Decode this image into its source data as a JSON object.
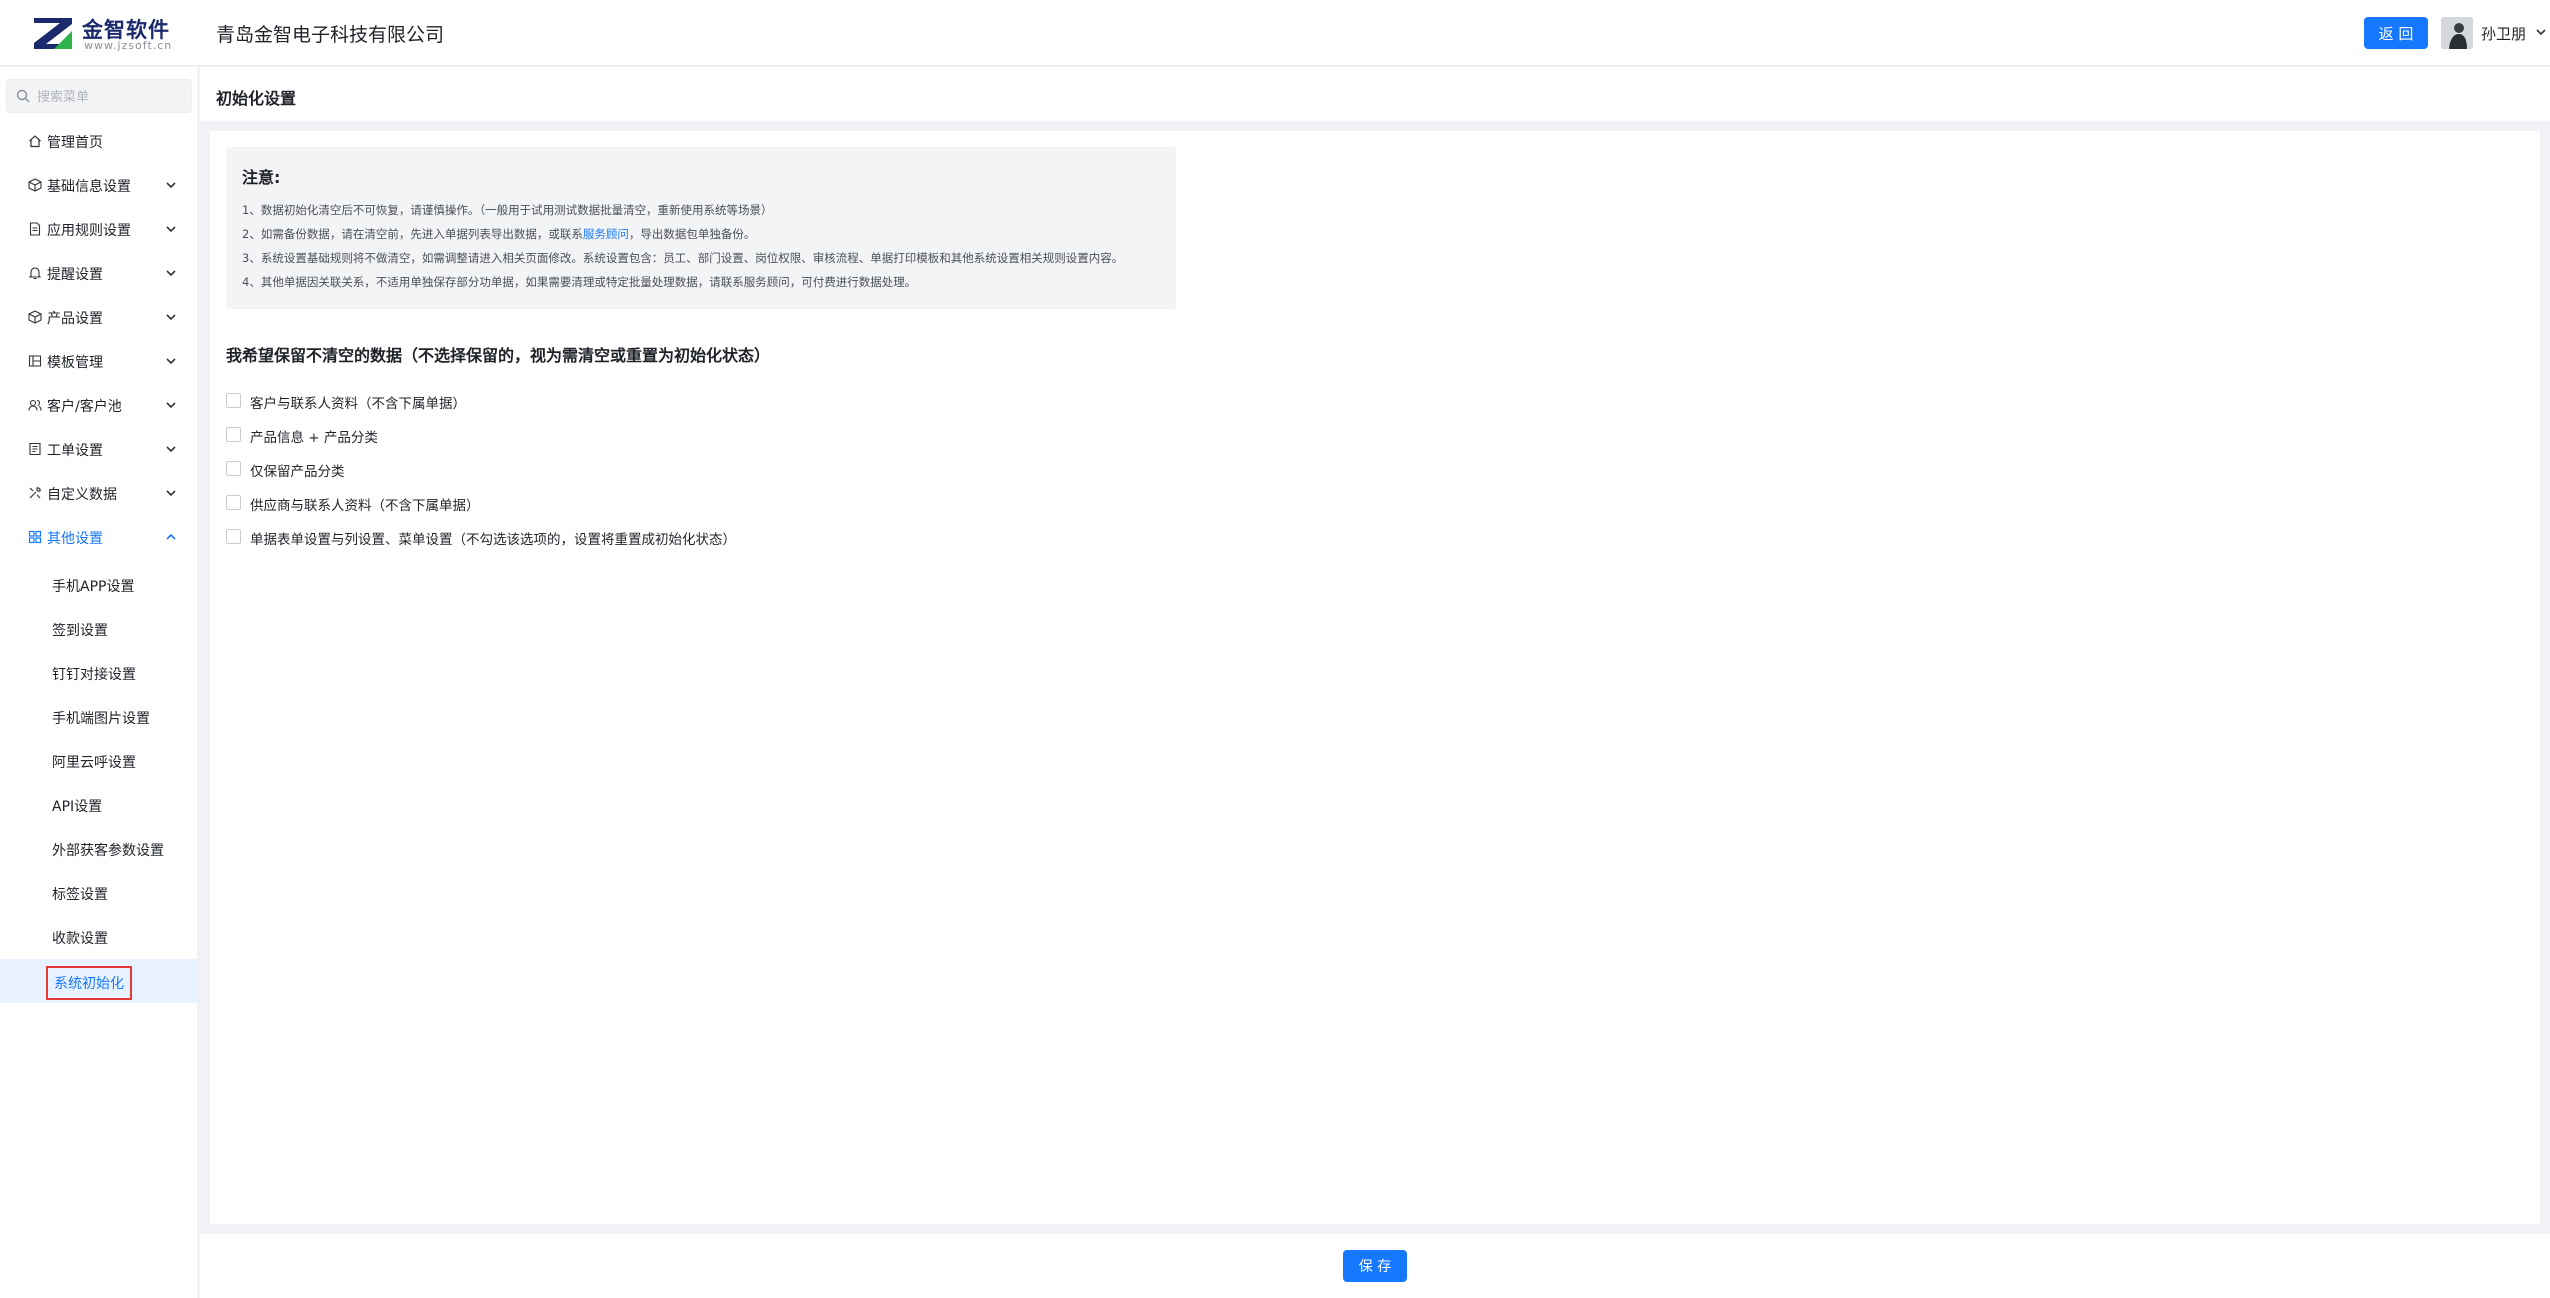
{
  "header": {
    "logo_title": "金智软件",
    "logo_url": "www.jzsoft.cn",
    "company_name": "青岛金智电子科技有限公司",
    "back_label": "返 回",
    "user_name": "孙卫朋",
    "brand_color": "#1677ff"
  },
  "sidebar": {
    "search_placeholder": "搜索菜单",
    "items": [
      {
        "label": "管理首页",
        "icon": "home-icon"
      },
      {
        "label": "基础信息设置",
        "icon": "cube-icon"
      },
      {
        "label": "应用规则设置",
        "icon": "document-icon"
      },
      {
        "label": "提醒设置",
        "icon": "bell-icon"
      },
      {
        "label": "产品设置",
        "icon": "box-icon"
      },
      {
        "label": "模板管理",
        "icon": "template-icon"
      },
      {
        "label": "客户/客户池",
        "icon": "users-icon"
      },
      {
        "label": "工单设置",
        "icon": "ticket-icon"
      },
      {
        "label": "自定义数据",
        "icon": "tools-icon"
      },
      {
        "label": "其他设置",
        "icon": "grid-icon"
      }
    ],
    "subitems": [
      {
        "label": "手机APP设置"
      },
      {
        "label": "签到设置"
      },
      {
        "label": "钉钉对接设置"
      },
      {
        "label": "手机端图片设置"
      },
      {
        "label": "阿里云呼设置"
      },
      {
        "label": "API设置"
      },
      {
        "label": "外部获客参数设置"
      },
      {
        "label": "标签设置"
      },
      {
        "label": "收款设置"
      },
      {
        "label": "系统初始化"
      }
    ]
  },
  "page": {
    "title": "初始化设置",
    "notice_title": "注意:",
    "notice_lines": [
      "1、数据初始化清空后不可恢复，请谨慎操作。（一般用于试用测试数据批量清空，重新使用系统等场景）",
      "3、系统设置基础规则将不做清空，如需调整请进入相关页面修改。系统设置包含：员工、部门设置、岗位权限、审核流程、单据打印模板和其他系统设置相关规则设置内容。",
      "4、其他单据因关联关系，不适用单独保存部分功单据，如果需要清理或特定批量处理数据，请联系服务顾问，可付费进行数据处理。"
    ],
    "notice_line2_before": "2、如需备份数据，请在清空前，先进入单据列表导出数据，或联系",
    "notice_line2_link": "服务顾问",
    "notice_line2_after": "，导出数据包单独备份。",
    "section_heading": "我希望保留不清空的数据（不选择保留的，视为需清空或重置为初始化状态）",
    "options": [
      {
        "label": "客户与联系人资料（不含下属单据）",
        "checked": false
      },
      {
        "label": "产品信息 + 产品分类",
        "checked": false
      },
      {
        "label": "仅保留产品分类",
        "checked": false
      },
      {
        "label": "供应商与联系人资料（不含下属单据）",
        "checked": false
      },
      {
        "label": "单据表单设置与列设置、菜单设置（不勾选该选项的，设置将重置成初始化状态）",
        "checked": false
      }
    ],
    "save_label": "保 存"
  }
}
